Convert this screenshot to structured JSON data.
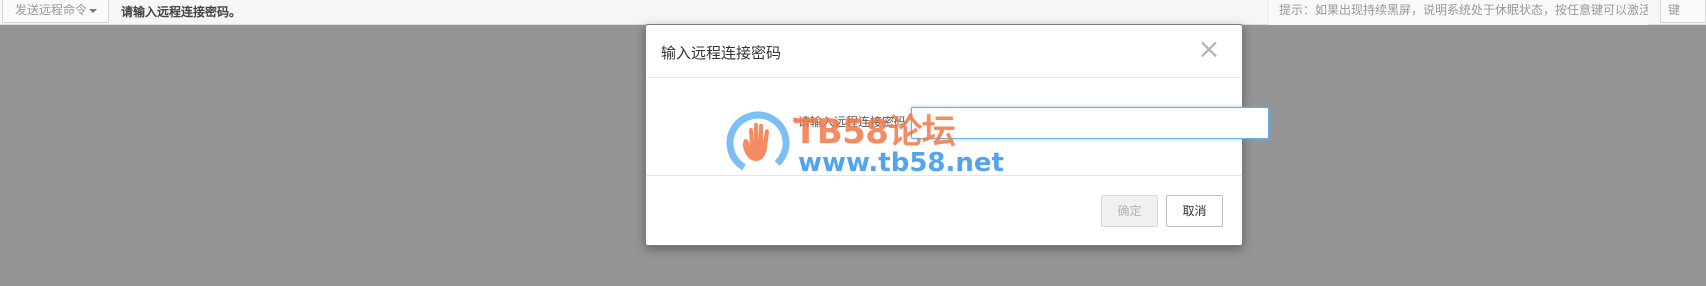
{
  "toolbar": {
    "send_command_label": "发送远程命令",
    "status_message": "请输入远程连接密码。",
    "tip": "提示：如果出现持续黑屏，说明系统处于休眠状态，按任意键可以激活。",
    "corner_button_label": "键"
  },
  "dialog": {
    "title": "输入远程连接密码",
    "close_icon": "×",
    "required_mark": "*",
    "field_label": "请输入远程连接密码",
    "password_value": "",
    "confirm_label": "确定",
    "cancel_label": "取消"
  },
  "watermark": {
    "main_text": "TB58论坛",
    "sub_text": "www.tb58.net"
  },
  "colors": {
    "backdrop": "#959595",
    "input_focus_border": "#66afe9",
    "watermark_orange": "#f17846",
    "watermark_blue": "#3c96eb"
  },
  "icons": {
    "dropdown": "chevron-down-icon",
    "close": "close-icon",
    "logo": "hand-logo-icon"
  }
}
